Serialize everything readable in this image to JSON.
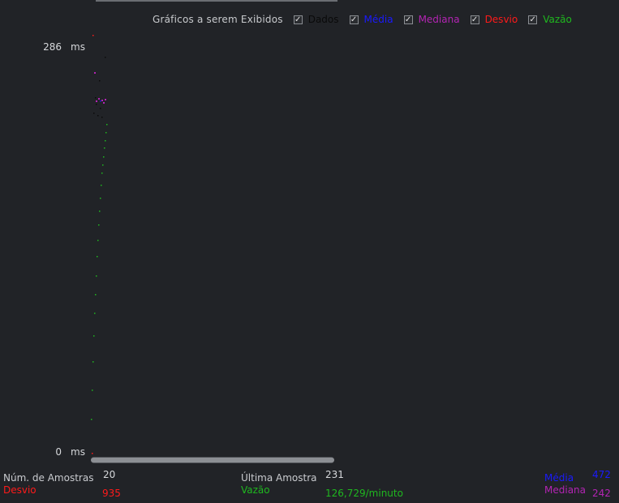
{
  "legend": {
    "title": "Gráficos a serem Exibidos",
    "items": [
      {
        "label": "Dados",
        "color": "#0a0a0a",
        "checked": true,
        "check_glyph": "✓"
      },
      {
        "label": "Média",
        "color": "#1a1aff",
        "checked": true,
        "check_glyph": "✓"
      },
      {
        "label": "Mediana",
        "color": "#b324b3",
        "checked": true,
        "check_glyph": "✓"
      },
      {
        "label": "Desvio",
        "color": "#ff1a1a",
        "checked": true,
        "check_glyph": "✓"
      },
      {
        "label": "Vazão",
        "color": "#1fb81f",
        "checked": true,
        "check_glyph": "✓"
      }
    ]
  },
  "y_axis": {
    "max": "286",
    "min": "0",
    "unit": "ms"
  },
  "stats": {
    "num_amostras_label": "Núm. de Amostras",
    "num_amostras_value": "20",
    "ultima_amostra_label": "Última Amostra",
    "ultima_amostra_value": "231",
    "media_label": "Média",
    "media_value": "472",
    "desvio_label": "Desvio",
    "desvio_value": "935",
    "vazao_label": "Vazão",
    "vazao_value": "126,729/minuto",
    "mediana_label": "Mediana",
    "mediana_value": "242"
  },
  "colors": {
    "background": "#212327",
    "dados": "#0a0a0a",
    "media": "#1a1aff",
    "mediana": "#b324b3",
    "desvio": "#ff1a1a",
    "vazao": "#1fb81f"
  }
}
